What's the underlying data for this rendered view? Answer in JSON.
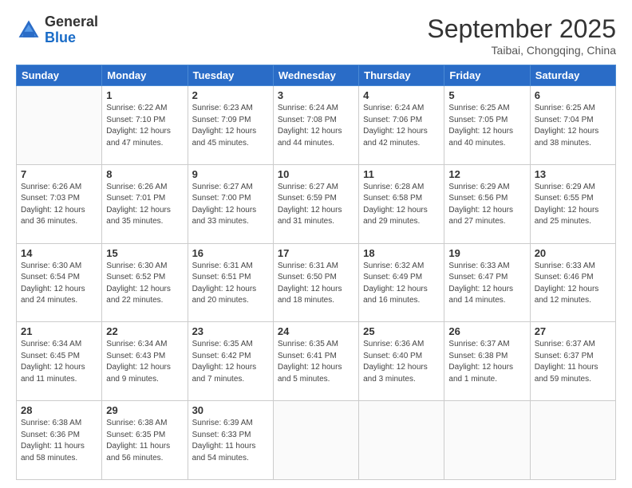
{
  "header": {
    "logo": {
      "general": "General",
      "blue": "Blue"
    },
    "title": "September 2025",
    "subtitle": "Taibai, Chongqing, China"
  },
  "calendar": {
    "weekdays": [
      "Sunday",
      "Monday",
      "Tuesday",
      "Wednesday",
      "Thursday",
      "Friday",
      "Saturday"
    ],
    "weeks": [
      [
        {
          "day": null
        },
        {
          "day": 1,
          "sunrise": "6:22 AM",
          "sunset": "7:10 PM",
          "daylight": "12 hours and 47 minutes."
        },
        {
          "day": 2,
          "sunrise": "6:23 AM",
          "sunset": "7:09 PM",
          "daylight": "12 hours and 45 minutes."
        },
        {
          "day": 3,
          "sunrise": "6:24 AM",
          "sunset": "7:08 PM",
          "daylight": "12 hours and 44 minutes."
        },
        {
          "day": 4,
          "sunrise": "6:24 AM",
          "sunset": "7:06 PM",
          "daylight": "12 hours and 42 minutes."
        },
        {
          "day": 5,
          "sunrise": "6:25 AM",
          "sunset": "7:05 PM",
          "daylight": "12 hours and 40 minutes."
        },
        {
          "day": 6,
          "sunrise": "6:25 AM",
          "sunset": "7:04 PM",
          "daylight": "12 hours and 38 minutes."
        }
      ],
      [
        {
          "day": 7,
          "sunrise": "6:26 AM",
          "sunset": "7:03 PM",
          "daylight": "12 hours and 36 minutes."
        },
        {
          "day": 8,
          "sunrise": "6:26 AM",
          "sunset": "7:01 PM",
          "daylight": "12 hours and 35 minutes."
        },
        {
          "day": 9,
          "sunrise": "6:27 AM",
          "sunset": "7:00 PM",
          "daylight": "12 hours and 33 minutes."
        },
        {
          "day": 10,
          "sunrise": "6:27 AM",
          "sunset": "6:59 PM",
          "daylight": "12 hours and 31 minutes."
        },
        {
          "day": 11,
          "sunrise": "6:28 AM",
          "sunset": "6:58 PM",
          "daylight": "12 hours and 29 minutes."
        },
        {
          "day": 12,
          "sunrise": "6:29 AM",
          "sunset": "6:56 PM",
          "daylight": "12 hours and 27 minutes."
        },
        {
          "day": 13,
          "sunrise": "6:29 AM",
          "sunset": "6:55 PM",
          "daylight": "12 hours and 25 minutes."
        }
      ],
      [
        {
          "day": 14,
          "sunrise": "6:30 AM",
          "sunset": "6:54 PM",
          "daylight": "12 hours and 24 minutes."
        },
        {
          "day": 15,
          "sunrise": "6:30 AM",
          "sunset": "6:52 PM",
          "daylight": "12 hours and 22 minutes."
        },
        {
          "day": 16,
          "sunrise": "6:31 AM",
          "sunset": "6:51 PM",
          "daylight": "12 hours and 20 minutes."
        },
        {
          "day": 17,
          "sunrise": "6:31 AM",
          "sunset": "6:50 PM",
          "daylight": "12 hours and 18 minutes."
        },
        {
          "day": 18,
          "sunrise": "6:32 AM",
          "sunset": "6:49 PM",
          "daylight": "12 hours and 16 minutes."
        },
        {
          "day": 19,
          "sunrise": "6:33 AM",
          "sunset": "6:47 PM",
          "daylight": "12 hours and 14 minutes."
        },
        {
          "day": 20,
          "sunrise": "6:33 AM",
          "sunset": "6:46 PM",
          "daylight": "12 hours and 12 minutes."
        }
      ],
      [
        {
          "day": 21,
          "sunrise": "6:34 AM",
          "sunset": "6:45 PM",
          "daylight": "12 hours and 11 minutes."
        },
        {
          "day": 22,
          "sunrise": "6:34 AM",
          "sunset": "6:43 PM",
          "daylight": "12 hours and 9 minutes."
        },
        {
          "day": 23,
          "sunrise": "6:35 AM",
          "sunset": "6:42 PM",
          "daylight": "12 hours and 7 minutes."
        },
        {
          "day": 24,
          "sunrise": "6:35 AM",
          "sunset": "6:41 PM",
          "daylight": "12 hours and 5 minutes."
        },
        {
          "day": 25,
          "sunrise": "6:36 AM",
          "sunset": "6:40 PM",
          "daylight": "12 hours and 3 minutes."
        },
        {
          "day": 26,
          "sunrise": "6:37 AM",
          "sunset": "6:38 PM",
          "daylight": "12 hours and 1 minute."
        },
        {
          "day": 27,
          "sunrise": "6:37 AM",
          "sunset": "6:37 PM",
          "daylight": "11 hours and 59 minutes."
        }
      ],
      [
        {
          "day": 28,
          "sunrise": "6:38 AM",
          "sunset": "6:36 PM",
          "daylight": "11 hours and 58 minutes."
        },
        {
          "day": 29,
          "sunrise": "6:38 AM",
          "sunset": "6:35 PM",
          "daylight": "11 hours and 56 minutes."
        },
        {
          "day": 30,
          "sunrise": "6:39 AM",
          "sunset": "6:33 PM",
          "daylight": "11 hours and 54 minutes."
        },
        {
          "day": null
        },
        {
          "day": null
        },
        {
          "day": null
        },
        {
          "day": null
        }
      ]
    ]
  }
}
